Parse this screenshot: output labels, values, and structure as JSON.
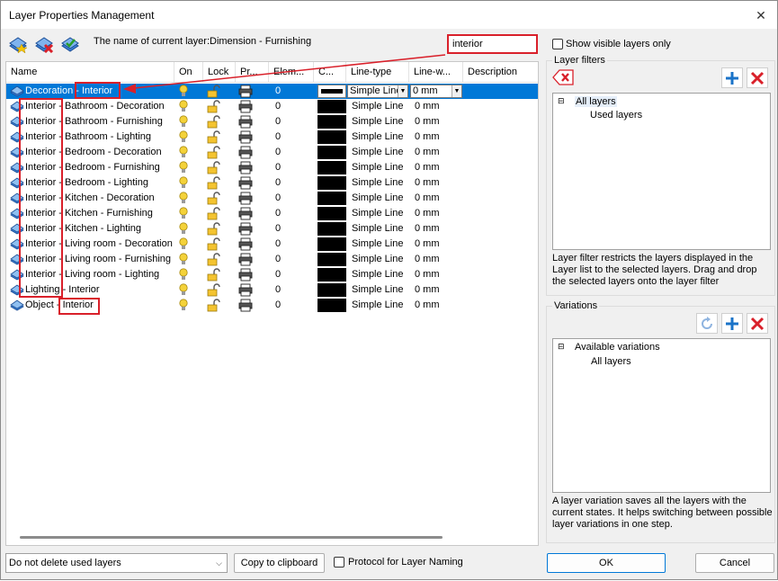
{
  "window": {
    "title": "Layer Properties Management"
  },
  "toolbar": {
    "buttons": [
      {
        "name": "new-layer-icon"
      },
      {
        "name": "delete-layer-icon"
      },
      {
        "name": "set-current-layer-icon"
      }
    ],
    "current_layer_text": "The name of current layer:Dimension - Furnishing",
    "search": {
      "value": "interior"
    }
  },
  "table": {
    "columns": [
      "Name",
      "On",
      "Lock",
      "Pr...",
      "Elem...",
      "C...",
      "Line-type",
      "Line-w...",
      "Description"
    ],
    "rows": [
      {
        "name": "Decoration - Interior",
        "elements": "0",
        "linetype": "Simple Line",
        "lineweight": "0 mm",
        "selected": true
      },
      {
        "name": "Interior - Bathroom - Decoration",
        "elements": "0",
        "linetype": "Simple Line",
        "lineweight": "0 mm"
      },
      {
        "name": "Interior - Bathroom - Furnishing",
        "elements": "0",
        "linetype": "Simple Line",
        "lineweight": "0 mm"
      },
      {
        "name": "Interior - Bathroom - Lighting",
        "elements": "0",
        "linetype": "Simple Line",
        "lineweight": "0 mm"
      },
      {
        "name": "Interior - Bedroom - Decoration",
        "elements": "0",
        "linetype": "Simple Line",
        "lineweight": "0 mm"
      },
      {
        "name": "Interior - Bedroom - Furnishing",
        "elements": "0",
        "linetype": "Simple Line",
        "lineweight": "0 mm"
      },
      {
        "name": "Interior - Bedroom - Lighting",
        "elements": "0",
        "linetype": "Simple Line",
        "lineweight": "0 mm"
      },
      {
        "name": "Interior - Kitchen - Decoration",
        "elements": "0",
        "linetype": "Simple Line",
        "lineweight": "0 mm"
      },
      {
        "name": "Interior - Kitchen - Furnishing",
        "elements": "0",
        "linetype": "Simple Line",
        "lineweight": "0 mm"
      },
      {
        "name": "Interior - Kitchen - Lighting",
        "elements": "0",
        "linetype": "Simple Line",
        "lineweight": "0 mm"
      },
      {
        "name": "Interior - Living room - Decoration",
        "elements": "0",
        "linetype": "Simple Line",
        "lineweight": "0 mm"
      },
      {
        "name": "Interior - Living room - Furnishing",
        "elements": "0",
        "linetype": "Simple Line",
        "lineweight": "0 mm"
      },
      {
        "name": "Interior - Living room - Lighting",
        "elements": "0",
        "linetype": "Simple Line",
        "lineweight": "0 mm"
      },
      {
        "name": "Lighting - Interior",
        "elements": "0",
        "linetype": "Simple Line",
        "lineweight": "0 mm"
      },
      {
        "name": "Object - Interior",
        "elements": "0",
        "linetype": "Simple Line",
        "lineweight": "0 mm"
      }
    ]
  },
  "right": {
    "show_visible_label": "Show visible layers only",
    "filters": {
      "title": "Layer filters",
      "tree": {
        "root": "All layers",
        "child": "Used layers"
      },
      "help": "Layer filter restricts the layers displayed in the Layer list to the selected layers. Drag and drop the selected layers onto the layer filter"
    },
    "variations": {
      "title": "Variations",
      "tree": {
        "root": "Available variations",
        "child": "All layers"
      },
      "help": "A layer variation saves all the layers with the current states. It helps switching between possible layer variations in one step."
    }
  },
  "bottom": {
    "delete_option": "Do not delete used layers",
    "copy_label": "Copy to clipboard",
    "protocol_label": "Protocol for Layer Naming",
    "ok_label": "OK",
    "cancel_label": "Cancel"
  },
  "colors": {
    "selection": "#0078d7",
    "highlight": "#d9202a",
    "accent_blue": "#1a73c8",
    "danger_red": "#d9202a"
  }
}
